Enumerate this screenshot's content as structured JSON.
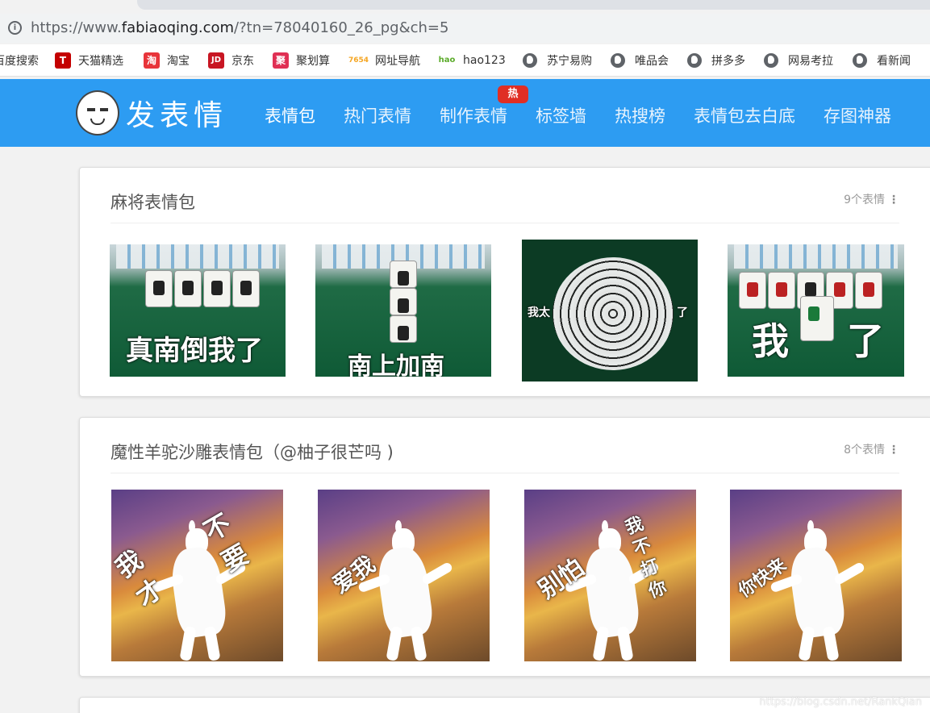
{
  "browser": {
    "url_prefix": "https://www.",
    "url_domain": "fabiaoqing.com",
    "url_rest": "/?tn=78040160_26_pg&ch=5"
  },
  "bookmarks": [
    {
      "label": "百度搜索",
      "icon": "baidu-icon"
    },
    {
      "label": "天猫精选",
      "icon": "tmall-icon",
      "glyph": "T",
      "color": "#c40000"
    },
    {
      "label": "淘宝",
      "icon": "taobao-icon",
      "glyph": "淘",
      "color": "#e8343a"
    },
    {
      "label": "京东",
      "icon": "jd-icon",
      "glyph": "JD",
      "color": "#c81623"
    },
    {
      "label": "聚划算",
      "icon": "juhuasuan-icon",
      "glyph": "聚",
      "color": "#e03054"
    },
    {
      "label": "网址导航",
      "icon": "7654-icon",
      "glyph": "7654",
      "color": "#f5a623"
    },
    {
      "label": "hao123",
      "icon": "hao123-icon",
      "glyph": "hao",
      "color": "#5bab2a"
    },
    {
      "label": "苏宁易购",
      "icon": "globe-icon"
    },
    {
      "label": "唯品会",
      "icon": "globe-icon"
    },
    {
      "label": "拼多多",
      "icon": "globe-icon"
    },
    {
      "label": "网易考拉",
      "icon": "globe-icon"
    },
    {
      "label": "看新闻",
      "icon": "globe-icon"
    }
  ],
  "site": {
    "logo_text": "发表情",
    "nav": [
      "表情包",
      "热门表情",
      "制作表情",
      "标签墙",
      "热搜榜",
      "表情包去白底",
      "存图神器"
    ],
    "hot_badge": "热",
    "header_color": "#2d9cf2"
  },
  "sections": [
    {
      "title": "麻将表情包",
      "count": "9个表情",
      "items": [
        {
          "caption": "真南倒我了"
        },
        {
          "caption": "南上加南"
        },
        {
          "caption_left": "我太",
          "caption_right": "了"
        },
        {
          "caption_left": "我",
          "caption_right": "了"
        }
      ]
    },
    {
      "title": "魔性羊驼沙雕表情包（@柚子很芒吗 )",
      "count": "8个表情",
      "items": [
        {
          "caption_a": "我才",
          "caption_b": "不要"
        },
        {
          "caption": "爱我"
        },
        {
          "caption_a": "别怕",
          "caption_b": "我不打你"
        },
        {
          "caption": "你快来"
        }
      ]
    }
  ],
  "watermark": "https://blog.csdn.net/RankQian"
}
